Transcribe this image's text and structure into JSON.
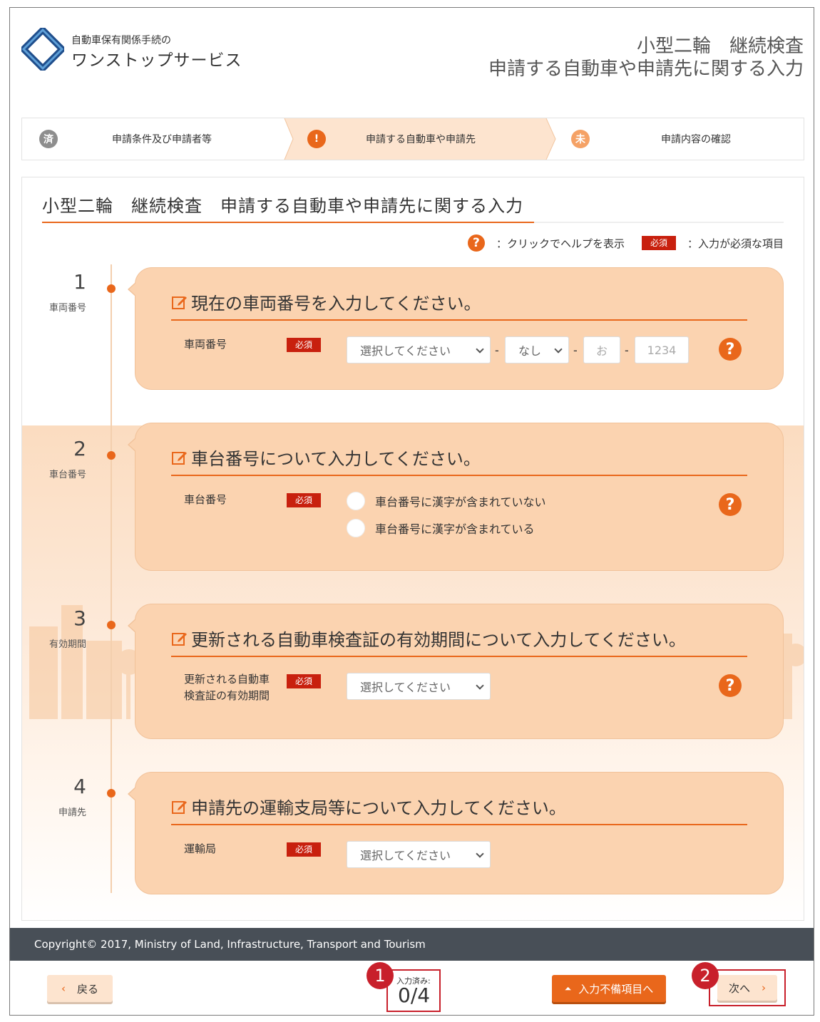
{
  "header": {
    "logo_sub": "自動車保有関係手続の",
    "logo_main": "ワンストップサービス",
    "title_line1": "小型二輪　継続検査",
    "title_line2": "申請する自動車や申請先に関する入力"
  },
  "stepper": [
    {
      "badge": "済",
      "label": "申請条件及び申請者等",
      "state": "done"
    },
    {
      "badge": "!",
      "label": "申請する自動車や申請先",
      "state": "current"
    },
    {
      "badge": "未",
      "label": "申請内容の確認",
      "state": "todo"
    }
  ],
  "page_title": "小型二輪　継続検査　申請する自動車や申請先に関する入力",
  "legend": {
    "help_text": "：クリックでヘルプを表示",
    "required_badge": "必須",
    "required_text": "：入力が必須な項目"
  },
  "sections": [
    {
      "num": "1",
      "label": "車両番号",
      "heading": "現在の車両番号を入力してください。",
      "field_label": "車両番号",
      "required": "必須",
      "select1": "選択してください",
      "select2": "なし",
      "input_kana": "お",
      "input_number": "1234",
      "dash": "-"
    },
    {
      "num": "2",
      "label": "車台番号",
      "heading": "車台番号について入力してください。",
      "field_label": "車台番号",
      "required": "必須",
      "radio1": "車台番号に漢字が含まれていない",
      "radio2": "車台番号に漢字が含まれている"
    },
    {
      "num": "3",
      "label": "有効期間",
      "heading": "更新される自動車検査証の有効期間について入力してください。",
      "field_label_1": "更新される自動車",
      "field_label_2": "検査証の有効期間",
      "required": "必須",
      "select": "選択してください"
    },
    {
      "num": "4",
      "label": "申請先",
      "heading": "申請先の運輸支局等について入力してください。",
      "field_label": "運輸局",
      "required": "必須",
      "select": "選択してください"
    }
  ],
  "help_icon": "?",
  "footer": {
    "copyright": "Copyright© 2017, Ministry of Land, Infrastructure, Transport and Tourism"
  },
  "bottom": {
    "back": "戻る",
    "progress_label": "入力済み:",
    "progress_value": "0/4",
    "incomplete": "入力不備項目へ",
    "next": "次へ",
    "marker1": "1",
    "marker2": "2"
  },
  "colors": {
    "accent": "#e9671b",
    "card": "#fbd3b0",
    "required": "#c8200e",
    "marker": "#c8202b",
    "footer": "#484f57"
  }
}
